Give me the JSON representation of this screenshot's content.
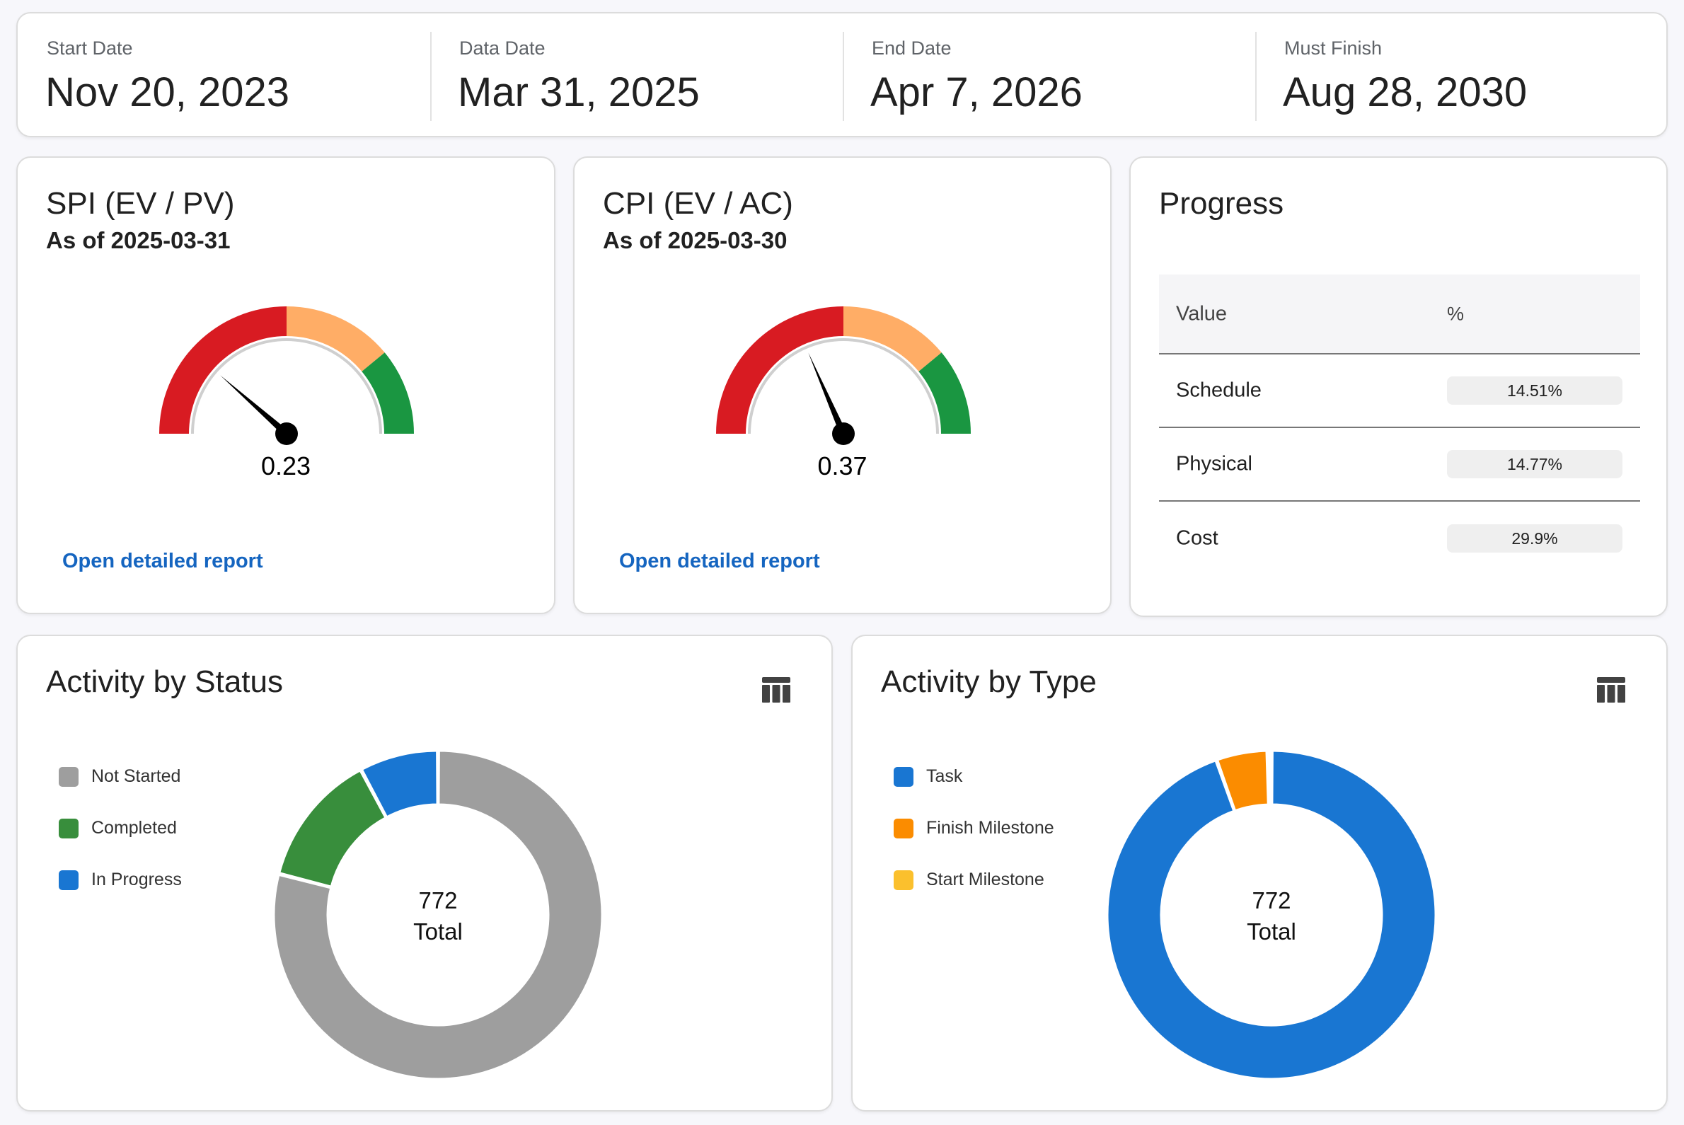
{
  "dates": [
    {
      "label": "Start Date",
      "value": "Nov 20, 2023"
    },
    {
      "label": "Data Date",
      "value": "Mar 31, 2025"
    },
    {
      "label": "End Date",
      "value": "Apr 7, 2026"
    },
    {
      "label": "Must Finish",
      "value": "Aug 28, 2030"
    }
  ],
  "spi": {
    "title": "SPI (EV / PV)",
    "subtitle": "As of 2025-03-31",
    "value": 0.23,
    "value_text": "0.23",
    "link": "Open detailed report"
  },
  "cpi": {
    "title": "CPI (EV / AC)",
    "subtitle": "As of 2025-03-30",
    "value": 0.37,
    "value_text": "0.37",
    "link": "Open detailed report"
  },
  "gauge_colors": {
    "red": "#d81b22",
    "orange": "#ffad66",
    "green": "#1a9641"
  },
  "progress": {
    "title": "Progress",
    "headers": [
      "Value",
      "%"
    ],
    "rows": [
      {
        "label": "Schedule",
        "value": "14.51%"
      },
      {
        "label": "Physical",
        "value": "14.77%"
      },
      {
        "label": "Cost",
        "value": "29.9%"
      }
    ]
  },
  "status": {
    "title": "Activity by Status",
    "table_icon": "table-icon",
    "center_value": "772",
    "center_label": "Total"
  },
  "type": {
    "title": "Activity by Type",
    "table_icon": "table-icon",
    "center_value": "772",
    "center_label": "Total"
  },
  "chart_data": [
    {
      "type": "pie",
      "title": "Activity by Status",
      "categories": [
        "Not Started",
        "Completed",
        "In Progress"
      ],
      "values": [
        610,
        102,
        60
      ],
      "colors": [
        "#9e9e9e",
        "#388e3c",
        "#1976d2"
      ],
      "legend": "left"
    },
    {
      "type": "pie",
      "title": "Activity by Type",
      "categories": [
        "Task",
        "Finish Milestone",
        "Start Milestone"
      ],
      "values": [
        730,
        39,
        3
      ],
      "colors": [
        "#1976d2",
        "#fb8c00",
        "#fbc02d"
      ],
      "legend": "left"
    }
  ]
}
